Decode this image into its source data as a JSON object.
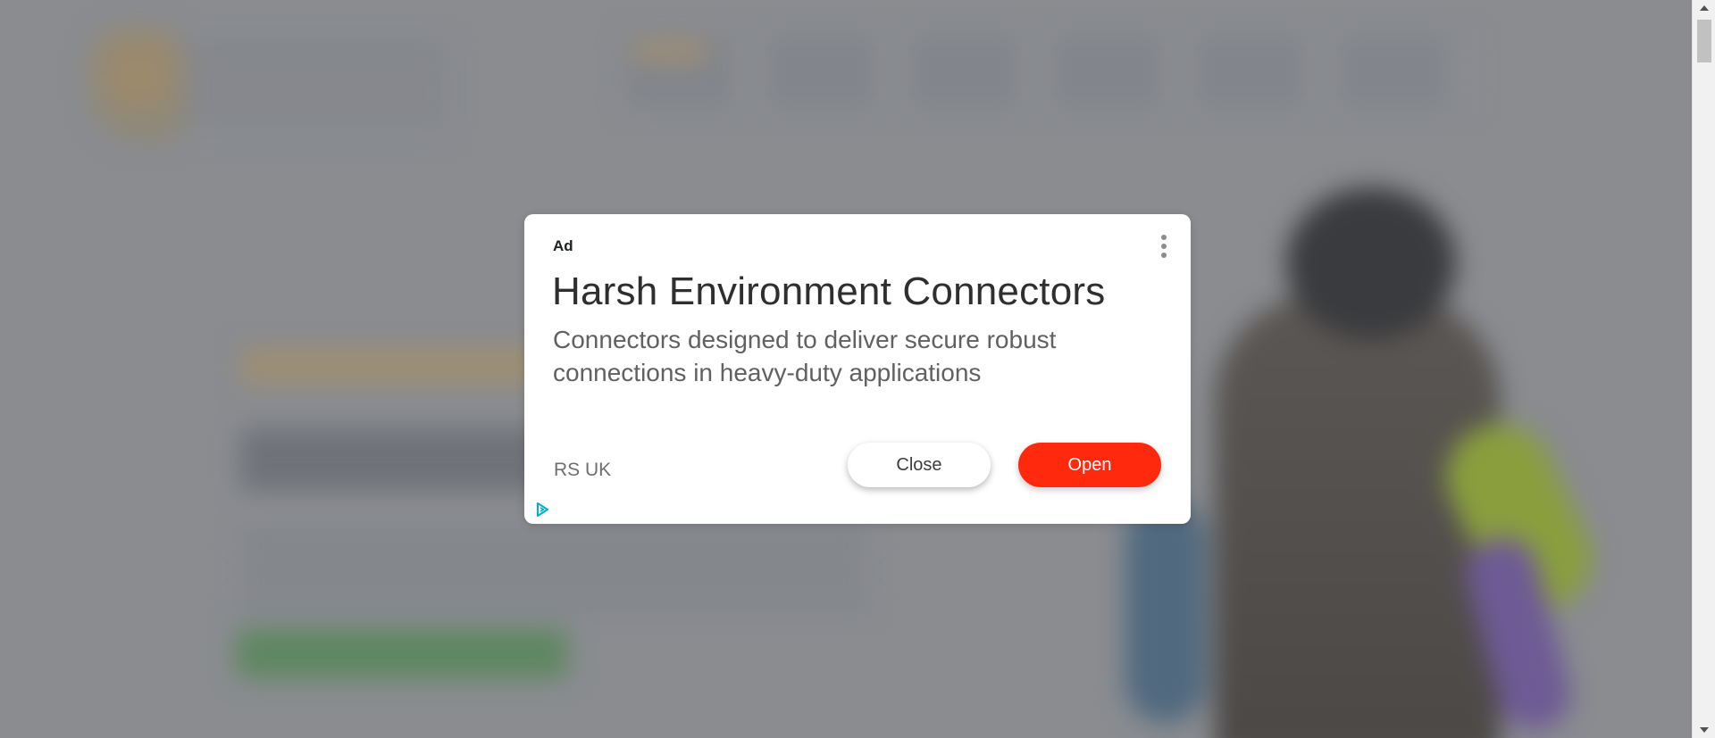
{
  "ad": {
    "label": "Ad",
    "title": "Harsh Environment Connectors",
    "description": "Connectors designed to deliver secure robust connections in heavy-duty applications",
    "advertiser": "RS UK",
    "close_label": "Close",
    "open_label": "Open",
    "menu_icon": "more-vert-icon",
    "adchoices_icon": "adchoices-icon"
  },
  "colors": {
    "open_button": "#ff2a0d",
    "overlay": "#8a8c90",
    "adchoices": "#00aecd"
  }
}
